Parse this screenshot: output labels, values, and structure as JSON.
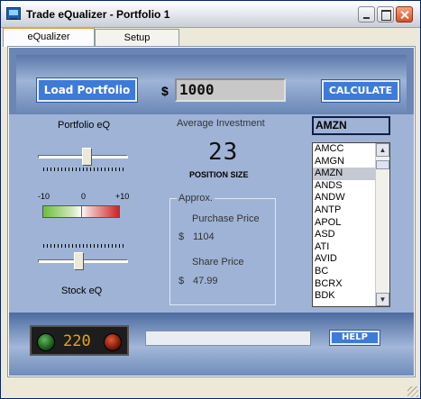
{
  "window": {
    "title": "Trade eQualizer  -  Portfolio 1"
  },
  "tabs": [
    {
      "label": "eQualizer",
      "active": true
    },
    {
      "label": "Setup",
      "active": false
    }
  ],
  "toolbar": {
    "load_label": "Load Portfolio",
    "currency": "$",
    "amount": "1000",
    "calculate_label": "CALCULATE"
  },
  "eq": {
    "portfolio_label": "Portfolio eQ",
    "stock_label": "Stock eQ",
    "scale": {
      "min": "-10",
      "mid": "0",
      "max": "+10"
    },
    "portfolio_level": 0.55,
    "stock_level": 0.45
  },
  "results": {
    "avg_label": "Average Investment",
    "position_size": "23",
    "position_label": "POSITION SIZE",
    "approx_label": "Approx.",
    "purchase_label": "Purchase Price",
    "purchase_currency": "$",
    "purchase_value": "1104",
    "share_label": "Share Price",
    "share_currency": "$",
    "share_value": "47.99"
  },
  "ticker": {
    "selected": "AMZN",
    "items": [
      "AMCC",
      "AMGN",
      "AMZN",
      "ANDS",
      "ANDW",
      "ANTP",
      "APOL",
      "ASD",
      "ATI",
      "AVID",
      "BC",
      "BCRX",
      "BDK"
    ]
  },
  "footer": {
    "count": "220",
    "help_label": "HELP"
  },
  "colors": {
    "panel": "#6a86b4",
    "button": "#3e7bd8",
    "counter_text": "#e8a317"
  }
}
